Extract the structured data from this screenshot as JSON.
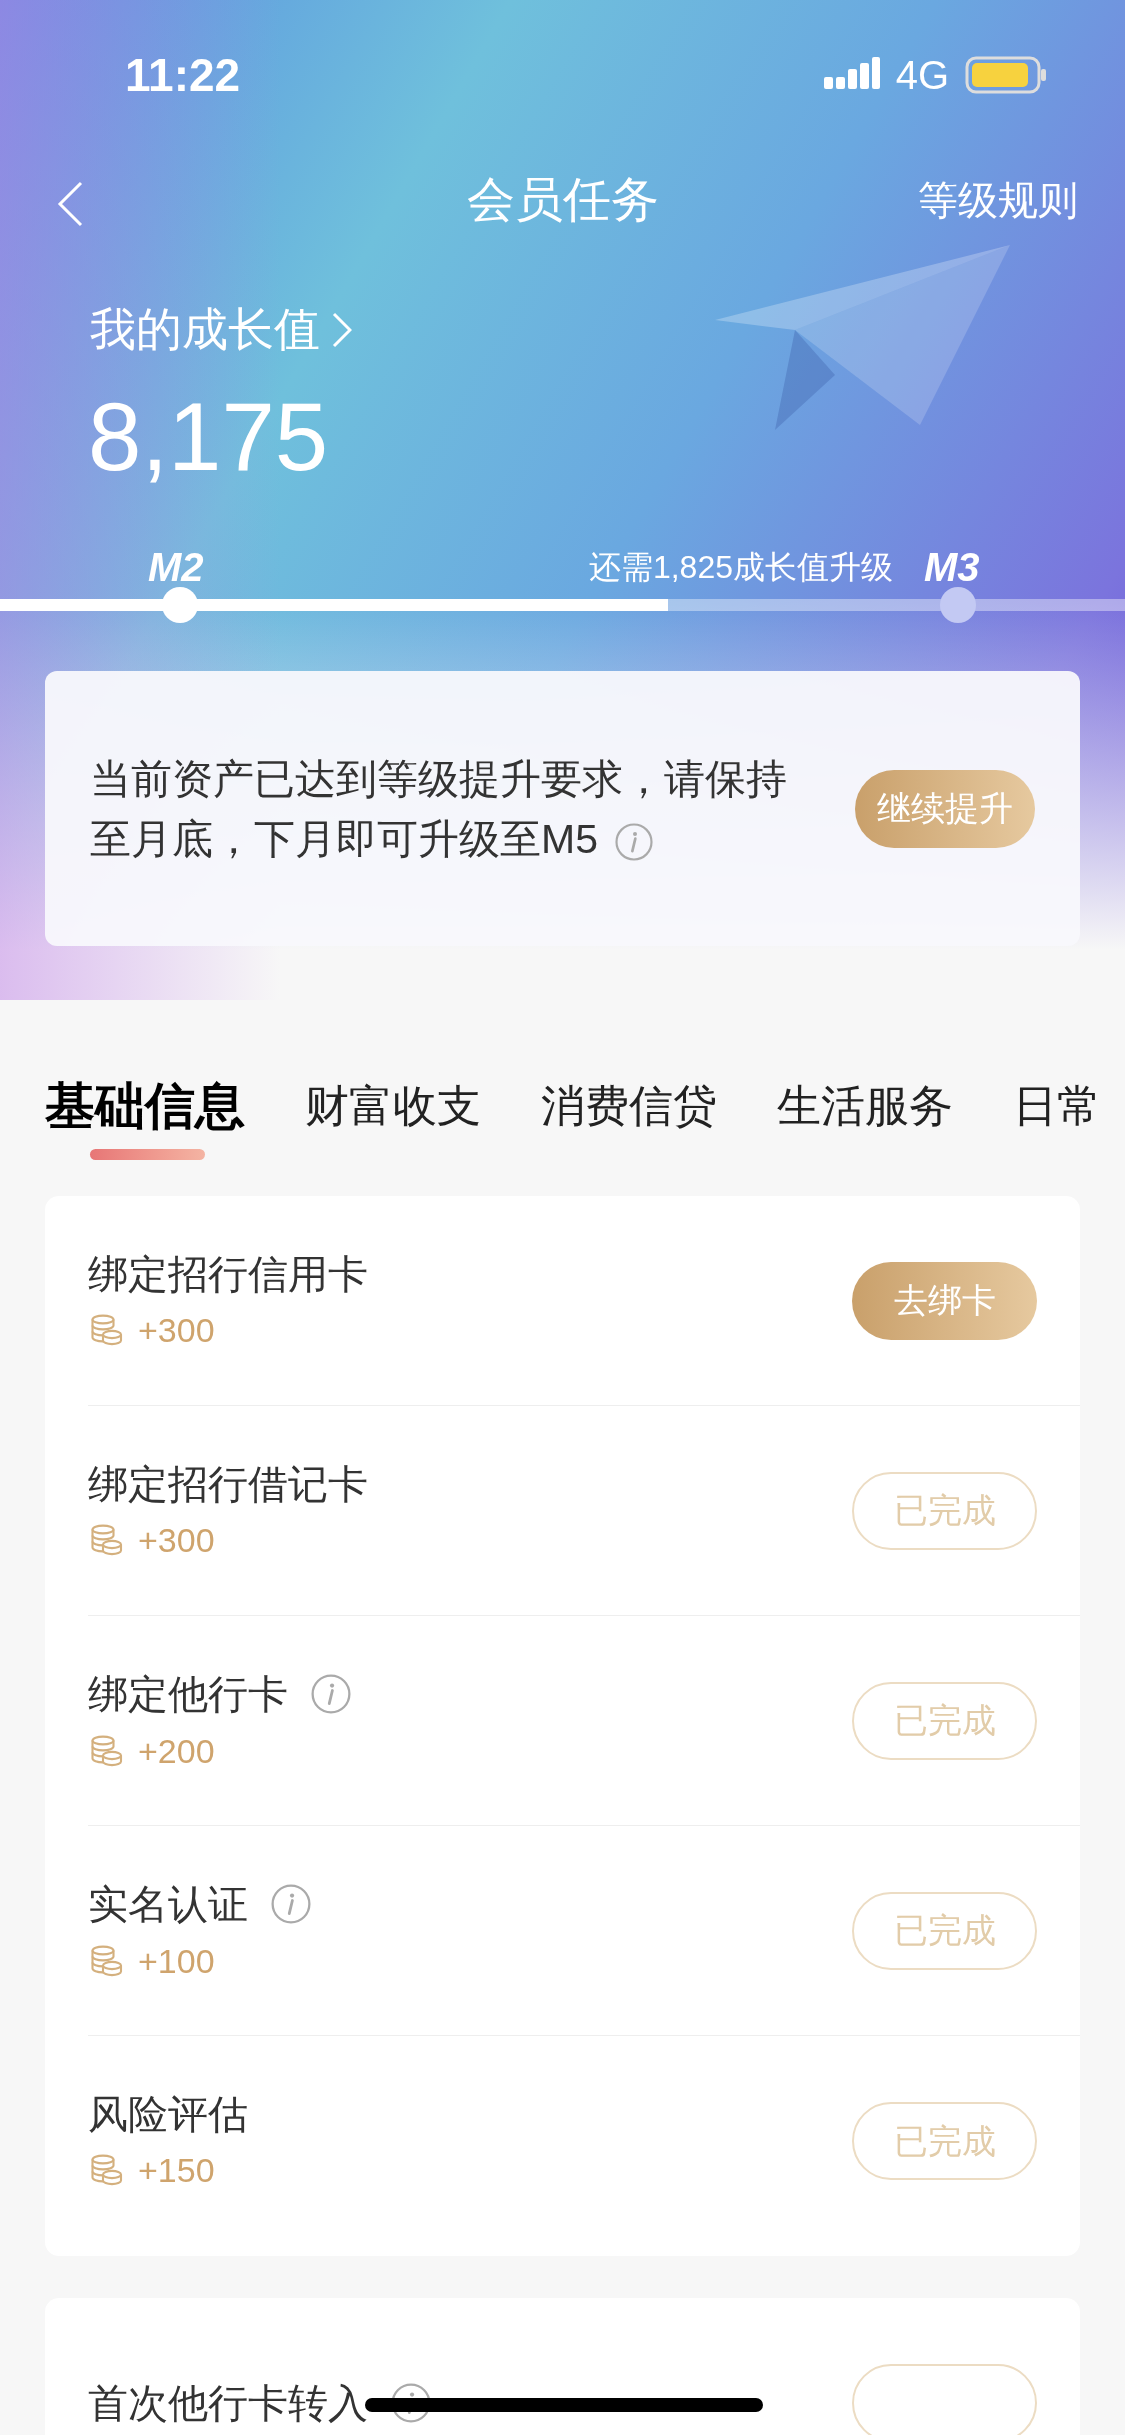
{
  "status_bar": {
    "time": "11:22",
    "network": "4G"
  },
  "nav": {
    "title": "会员任务",
    "right_link": "等级规则"
  },
  "growth": {
    "label": "我的成长值",
    "value": "8,175",
    "current_level": "M2",
    "next_level": "M3",
    "hint": "还需1,825成长值升级",
    "level": 0.594
  },
  "notice": {
    "text": "当前资产已达到等级提升要求，请保持至月底，下月即可升级至M5",
    "button": "继续提升"
  },
  "tabs": [
    {
      "label": "基础信息",
      "selected": true
    },
    {
      "label": "财富收支",
      "selected": false
    },
    {
      "label": "消费信贷",
      "selected": false
    },
    {
      "label": "生活服务",
      "selected": false
    },
    {
      "label": "日常",
      "selected": false
    }
  ],
  "task_groups": [
    {
      "tasks": [
        {
          "title": "绑定招行信用卡",
          "info": false,
          "points": "+300",
          "action": {
            "kind": "go",
            "label": "去绑卡"
          }
        },
        {
          "title": "绑定招行借记卡",
          "info": false,
          "points": "+300",
          "action": {
            "kind": "done",
            "label": "已完成"
          }
        },
        {
          "title": "绑定他行卡",
          "info": true,
          "points": "+200",
          "action": {
            "kind": "done",
            "label": "已完成"
          }
        },
        {
          "title": "实名认证",
          "info": true,
          "points": "+100",
          "action": {
            "kind": "done",
            "label": "已完成"
          }
        },
        {
          "title": "风险评估",
          "info": false,
          "points": "+150",
          "action": {
            "kind": "done",
            "label": "已完成"
          }
        }
      ]
    },
    {
      "tasks": [
        {
          "title": "首次他行卡转入",
          "info": true,
          "action": {
            "kind": "done"
          }
        }
      ]
    }
  ]
}
